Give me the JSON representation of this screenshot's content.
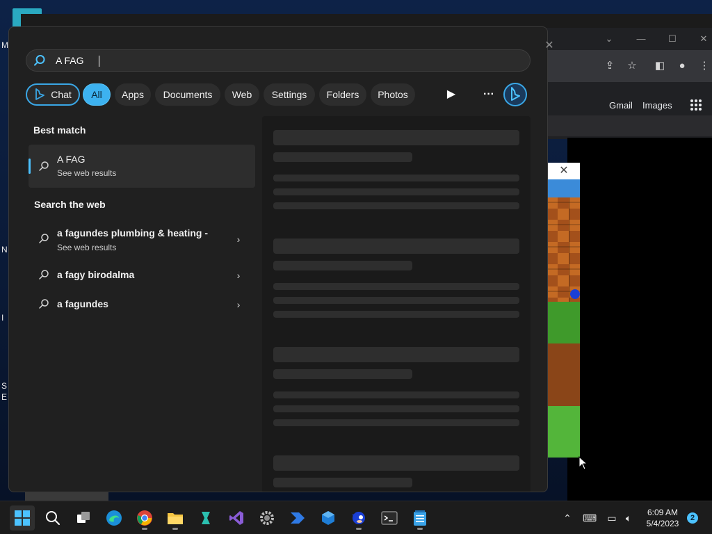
{
  "search": {
    "query": "A FAG",
    "placeholder": ""
  },
  "filters": {
    "chat": "Chat",
    "items": [
      "All",
      "Apps",
      "Documents",
      "Web",
      "Settings",
      "Folders",
      "Photos"
    ],
    "active": "All"
  },
  "results": {
    "best_match_heading": "Best match",
    "best_match": {
      "title": "A FAG",
      "subtitle": "See web results"
    },
    "web_heading": "Search the web",
    "web": [
      {
        "title": "a fagundes plumbing & heating -",
        "subtitle": "See web results"
      },
      {
        "title": "a fagy birodalma",
        "subtitle": ""
      },
      {
        "title": "a fagundes",
        "subtitle": ""
      }
    ]
  },
  "browser": {
    "links": [
      "Gmail",
      "Images"
    ]
  },
  "taskbar": {
    "apps": [
      "start-icon",
      "search-icon",
      "task-view-icon",
      "edge-icon",
      "chrome-icon",
      "file-explorer-icon",
      "app-teal-icon",
      "visual-studio-icon",
      "settings-icon",
      "power-automate-icon",
      "blue-cube-icon",
      "sonic-icon",
      "terminal-icon",
      "notepad-icon"
    ],
    "time": "6:09 AM",
    "date": "5/4/2023",
    "notification_count": "2"
  },
  "colors": {
    "accent": "#4cc2ff",
    "flyout_bg": "#202020",
    "chip_bg": "#2d2d2d"
  }
}
